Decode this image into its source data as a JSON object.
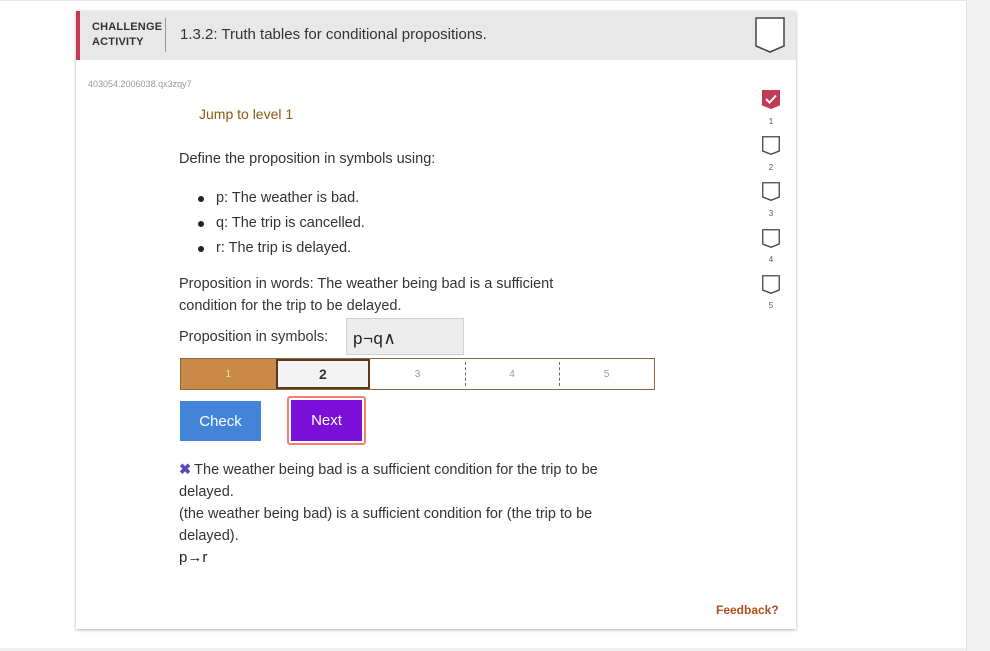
{
  "header": {
    "activity_type": "CHALLENGE ACTIVITY",
    "title": "1.3.2: Truth tables for conditional propositions."
  },
  "activity_code": "403054.2006038.qx3zqy7",
  "jump_link": "Jump to level 1",
  "question": {
    "prompt": "Define the proposition in symbols using:",
    "definitions": [
      "p: The weather is bad.",
      "q: The trip is cancelled.",
      "r: The trip is delayed."
    ],
    "words": "Proposition in words: The weather being bad is a sufficient condition for the trip to be delayed.",
    "symbols_label": "Proposition in symbols:",
    "symbols_value": "p¬q∧"
  },
  "levels": [
    {
      "label": "1",
      "state": "done"
    },
    {
      "label": "2",
      "state": "current"
    },
    {
      "label": "3",
      "state": "future"
    },
    {
      "label": "4",
      "state": "future"
    },
    {
      "label": "5",
      "state": "future"
    }
  ],
  "buttons": {
    "check": "Check",
    "next": "Next"
  },
  "feedback": {
    "line1": "The weather being bad is a sufficient condition for the trip to be delayed.",
    "line2": "(the weather being bad) is a sufficient condition for (the trip to be delayed).",
    "answer": "p→r"
  },
  "feedback_link": "Feedback?",
  "progress": [
    {
      "label": "1",
      "completed": true
    },
    {
      "label": "2",
      "completed": false
    },
    {
      "label": "3",
      "completed": false
    },
    {
      "label": "4",
      "completed": false
    },
    {
      "label": "5",
      "completed": false
    }
  ],
  "colors": {
    "accent": "#c23a54",
    "check_button": "#4285d8",
    "next_button": "#7a10d8",
    "level_done": "#c98a48",
    "feedback_link": "#b0501a"
  },
  "icons": {
    "activity_badge": "pentagon-badge-icon",
    "wrong": "x-mark-icon",
    "completed": "checkmark-icon"
  }
}
